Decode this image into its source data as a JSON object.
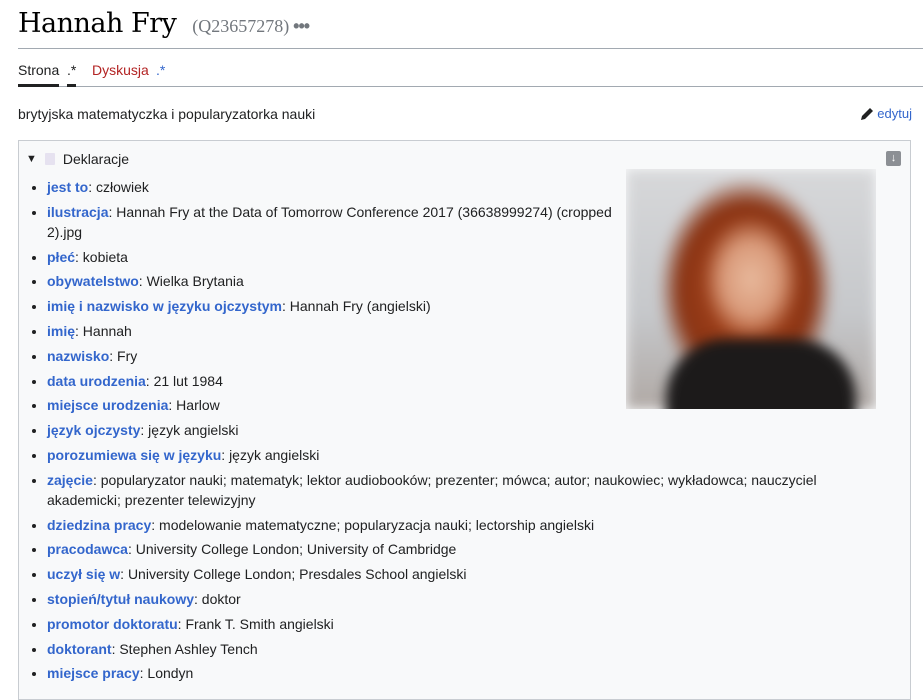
{
  "header": {
    "title": "Hannah Fry",
    "qid": "(Q23657278)",
    "more": "•••"
  },
  "tabs": [
    {
      "label": "Strona"
    },
    {
      "label": ".*"
    },
    {
      "label": "Dyskusja"
    },
    {
      "label": ".*"
    }
  ],
  "description": "brytyjska matematyczka i popularyzatorka nauki",
  "edit_label": "edytuj",
  "box": {
    "title": "Deklaracje",
    "image_alt": "Hannah Fry at the Data of Tomorrow Conference 2017 (36638999274) (cropped 2).jpg",
    "items": [
      {
        "label": "jest to",
        "value": "człowiek"
      },
      {
        "label": "ilustracja",
        "value": "Hannah Fry at the Data of Tomorrow Conference 2017 (36638999274) (cropped 2).jpg"
      },
      {
        "label": "płeć",
        "value": "kobieta"
      },
      {
        "label": "obywatelstwo",
        "value": "Wielka Brytania"
      },
      {
        "label": "imię i nazwisko w języku ojczystym",
        "value": "Hannah Fry (angielski)"
      },
      {
        "label": "imię",
        "value": "Hannah"
      },
      {
        "label": "nazwisko",
        "value": "Fry"
      },
      {
        "label": "data urodzenia",
        "value": "21 lut 1984"
      },
      {
        "label": "miejsce urodzenia",
        "value": "Harlow"
      },
      {
        "label": "język ojczysty",
        "value": "język angielski"
      },
      {
        "label": "porozumiewa się w języku",
        "value": "język angielski"
      },
      {
        "label": "zajęcie",
        "value": "popularyzator nauki; matematyk; lektor audiobooków; prezenter; mówca; autor; naukowiec; wykładowca; nauczyciel akademicki; prezenter telewizyjny"
      },
      {
        "label": "dziedzina pracy",
        "value": "modelowanie matematyczne; popularyzacja nauki; lectorship angielski"
      },
      {
        "label": "pracodawca",
        "value": "University College London; University of Cambridge"
      },
      {
        "label": "uczył się w",
        "value": "University College London; Presdales School angielski"
      },
      {
        "label": "stopień/tytuł naukowy",
        "value": "doktor"
      },
      {
        "label": "promotor doktoratu",
        "value": "Frank T. Smith angielski"
      },
      {
        "label": "doktorant",
        "value": "Stephen Ashley Tench"
      },
      {
        "label": "miejsce pracy",
        "value": "Londyn"
      }
    ]
  }
}
